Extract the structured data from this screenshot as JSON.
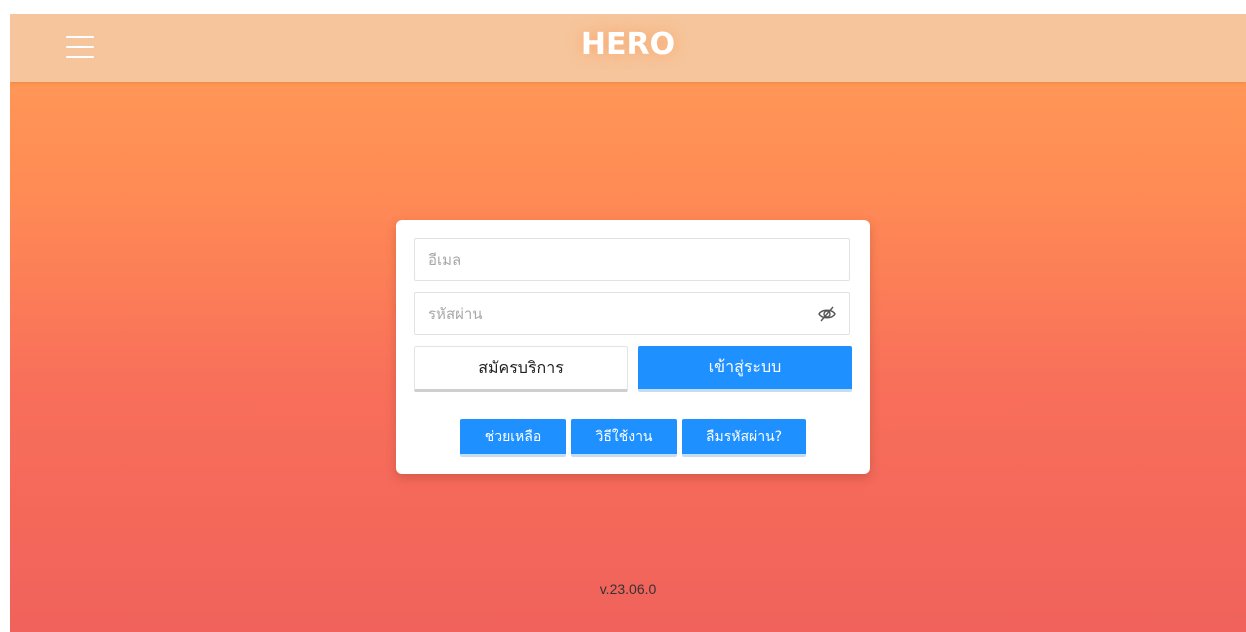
{
  "header": {
    "logo_text": "HERO",
    "menu_icon": "hamburger-menu-icon"
  },
  "login_form": {
    "email_placeholder": "อีเมล",
    "email_value": "",
    "password_placeholder": "รหัสผ่าน",
    "password_value": "",
    "password_toggle_icon": "eye-slash-icon",
    "register_label": "สมัครบริการ",
    "login_label": "เข้าสู่ระบบ",
    "help_label": "ช่วยเหลือ",
    "howto_label": "วิธีใช้งาน",
    "forgot_label": "ลืมรหัสผ่าน?"
  },
  "footer": {
    "version": "v.23.06.0"
  },
  "colors": {
    "header_bg": "#f6c59b",
    "gradient_top": "#ff9d56",
    "gradient_bottom": "#f0625b",
    "primary_button": "#1e90ff",
    "card_bg": "#ffffff"
  }
}
